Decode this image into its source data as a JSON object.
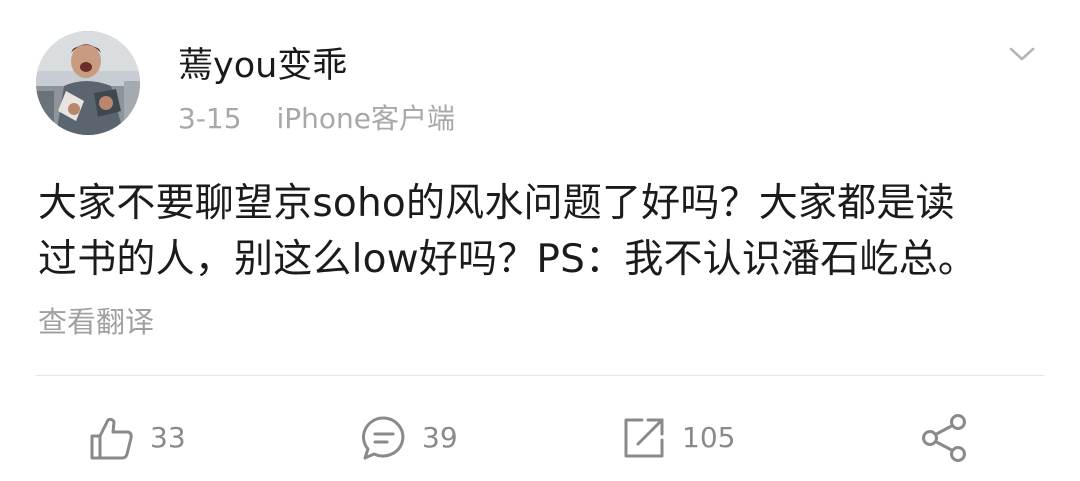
{
  "post": {
    "username": "蔫you变乖",
    "date": "3-15",
    "source": "iPhone客户端",
    "text_lines": [
      "大家不要聊望京soho的风水问题了好吗？大家都是读",
      "过书的人，别这么low好吗？PS：我不认识潘石屹总。"
    ],
    "translate_label": "查看翻译"
  },
  "actions": {
    "likes": "33",
    "comments": "39",
    "reposts": "105"
  },
  "icons": {
    "header": [
      "avatar",
      "chevron-down-icon"
    ],
    "actions": [
      "thumbs-up-icon",
      "comment-icon",
      "repost-icon",
      "share-icon"
    ]
  },
  "colors": {
    "text": "#1b1b1b",
    "meta": "#a8a8a8",
    "icon": "#8a8a8a",
    "divider": "#e6e6e6"
  }
}
